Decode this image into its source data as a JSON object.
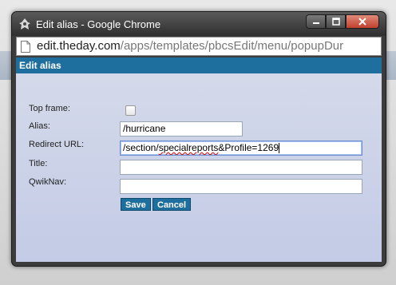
{
  "window": {
    "title": "Edit alias - Google Chrome"
  },
  "address_bar": {
    "host": "edit.theday.com",
    "path": "/apps/templates/pbcsEdit/menu/popupDur"
  },
  "dialog": {
    "header": "Edit alias",
    "fields": {
      "top_frame_label": "Top frame:",
      "alias_label": "Alias:",
      "alias_value": "/hurricane",
      "redirect_label": "Redirect URL:",
      "redirect_value_a": "/section/",
      "redirect_value_b": "specialreports",
      "redirect_value_c": "&Profile=1269",
      "title_label": "Title:",
      "title_value": "",
      "qwiknav_label": "QwikNav:",
      "qwiknav_value": ""
    },
    "buttons": {
      "save": "Save",
      "cancel": "Cancel"
    }
  },
  "colors": {
    "header_blue": "#1f6f9e",
    "form_bg": "#c8cfe8"
  },
  "icons": [
    "chrome-icon",
    "minimize-icon",
    "maximize-icon",
    "close-icon",
    "page-icon"
  ]
}
